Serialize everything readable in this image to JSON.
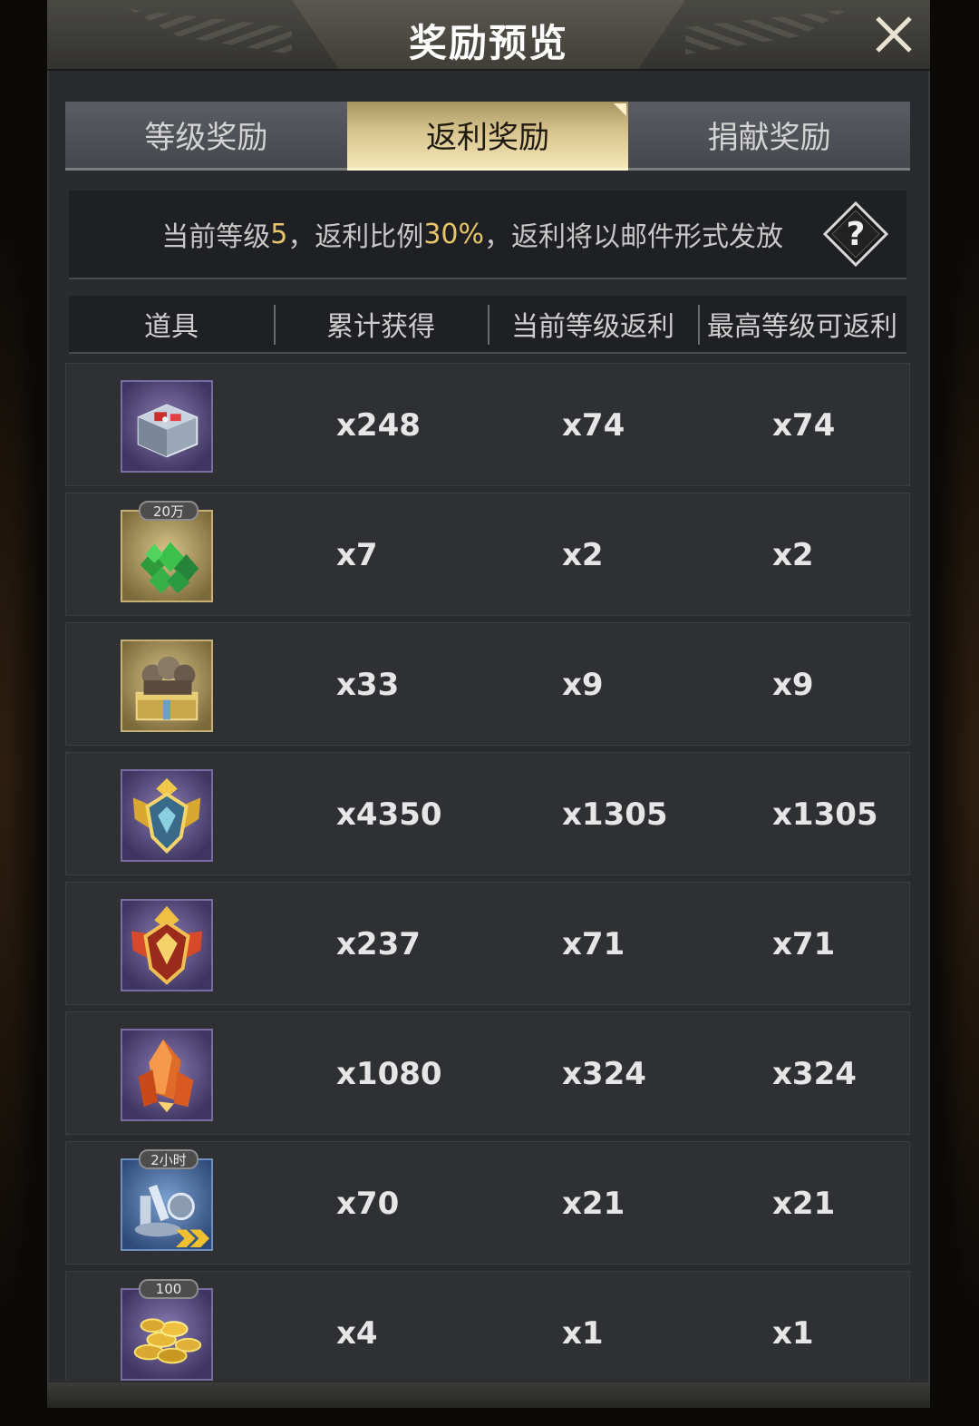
{
  "dialog": {
    "title": "奖励预览"
  },
  "tabs": [
    {
      "label": "等级奖励",
      "active": false
    },
    {
      "label": "返利奖励",
      "active": true
    },
    {
      "label": "捐献奖励",
      "active": false
    }
  ],
  "info": {
    "prefix": "当前等级",
    "level": "5",
    "middle": "，返利比例",
    "ratio": "30%",
    "suffix": "，返利将以邮件形式发放"
  },
  "table": {
    "headers": [
      "道具",
      "累计获得",
      "当前等级返利",
      "最高等级可返利"
    ],
    "rows": [
      {
        "icon": "treasure-chest-icon",
        "badge": "",
        "total": "x248",
        "current": "x74",
        "max": "x74"
      },
      {
        "icon": "green-gems-icon",
        "badge": "20万",
        "total": "x7",
        "current": "x2",
        "max": "x2"
      },
      {
        "icon": "hero-chest-icon",
        "badge": "",
        "total": "x33",
        "current": "x9",
        "max": "x9"
      },
      {
        "icon": "gold-emblem-icon",
        "badge": "",
        "total": "x4350",
        "current": "x1305",
        "max": "x1305"
      },
      {
        "icon": "red-emblem-icon",
        "badge": "",
        "total": "x237",
        "current": "x71",
        "max": "x71"
      },
      {
        "icon": "orange-crystal-icon",
        "badge": "",
        "total": "x1080",
        "current": "x324",
        "max": "x324"
      },
      {
        "icon": "research-speedup-icon",
        "badge": "2小时",
        "total": "x70",
        "current": "x21",
        "max": "x21"
      },
      {
        "icon": "gold-coins-icon",
        "badge": "100",
        "total": "x4",
        "current": "x1",
        "max": "x1"
      }
    ]
  },
  "colors": {
    "accent_gold": "#e6c46a",
    "active_tab": "#d8c48d"
  }
}
